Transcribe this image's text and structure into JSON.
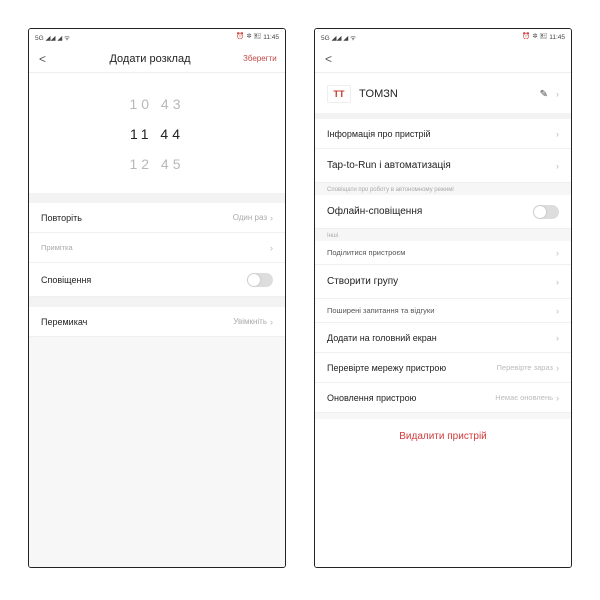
{
  "statusbar": {
    "left": "5G ◢◢ ◢ ᯤ",
    "right_icons": "⏰ ✲ 🖭",
    "time": "11:45"
  },
  "left": {
    "header": {
      "back": "<",
      "title": "Додати розклад",
      "save": "Зберегти"
    },
    "picker": {
      "prev": "10 43",
      "sel": "11 44",
      "next": "12 45"
    },
    "rows": {
      "repeat": {
        "label": "Повторіть",
        "value": "Один раз"
      },
      "note": {
        "label": "Примітка"
      },
      "notify": {
        "label": "Сповіщення"
      },
      "switch": {
        "label": "Перемикач",
        "value": "Увімкніть"
      }
    }
  },
  "right": {
    "device": {
      "logo": "TT",
      "name": "TOMЗN"
    },
    "rows": {
      "info": {
        "label": "Інформація про пристрій"
      },
      "auto": {
        "label": "Tap-to-Run і автоматизація"
      },
      "autonote": "Сповіщати про роботу в автономному режимі",
      "offline": {
        "label": "Офлайн-сповіщення"
      },
      "othernote": "Інші",
      "share": {
        "label": "Поділитися пристроєм"
      },
      "group": {
        "label": "Створити групу"
      },
      "faq": {
        "label": "Поширені запитання та відгуки"
      },
      "home": {
        "label": "Додати на головний екран"
      },
      "net": {
        "label": "Перевірте мережу пристрою",
        "value": "Перевірте зараз"
      },
      "upd": {
        "label": "Оновлення пристрою",
        "value": "Немає оновлень"
      }
    },
    "remove": "Видалити пристрій"
  }
}
